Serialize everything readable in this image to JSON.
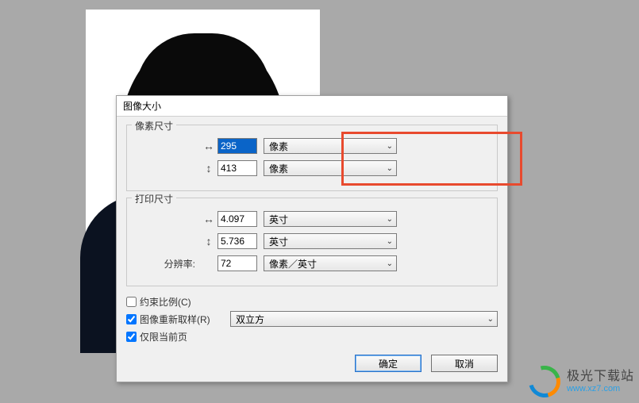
{
  "dialog": {
    "title": "图像大小",
    "pixel_section": {
      "legend": "像素尺寸",
      "width": {
        "value": "295",
        "unit": "像素"
      },
      "height": {
        "value": "413",
        "unit": "像素"
      }
    },
    "print_section": {
      "legend": "打印尺寸",
      "width": {
        "value": "4.097",
        "unit": "英寸"
      },
      "height": {
        "value": "5.736",
        "unit": "英寸"
      },
      "resolution": {
        "label": "分辨率:",
        "value": "72",
        "unit": "像素／英寸"
      }
    },
    "checks": {
      "constrain": {
        "label": "约束比例(C)",
        "checked": false
      },
      "resample": {
        "label": "图像重新取样(R)",
        "checked": true,
        "method": "双立方"
      },
      "current_page": {
        "label": "仅限当前页",
        "checked": true
      }
    },
    "buttons": {
      "ok": "确定",
      "cancel": "取消"
    }
  },
  "icons": {
    "width_arrow": "↔",
    "height_arrow": "↕",
    "dropdown": "⌄"
  },
  "watermark": {
    "name": "极光下载站",
    "url": "www.xz7.com"
  }
}
